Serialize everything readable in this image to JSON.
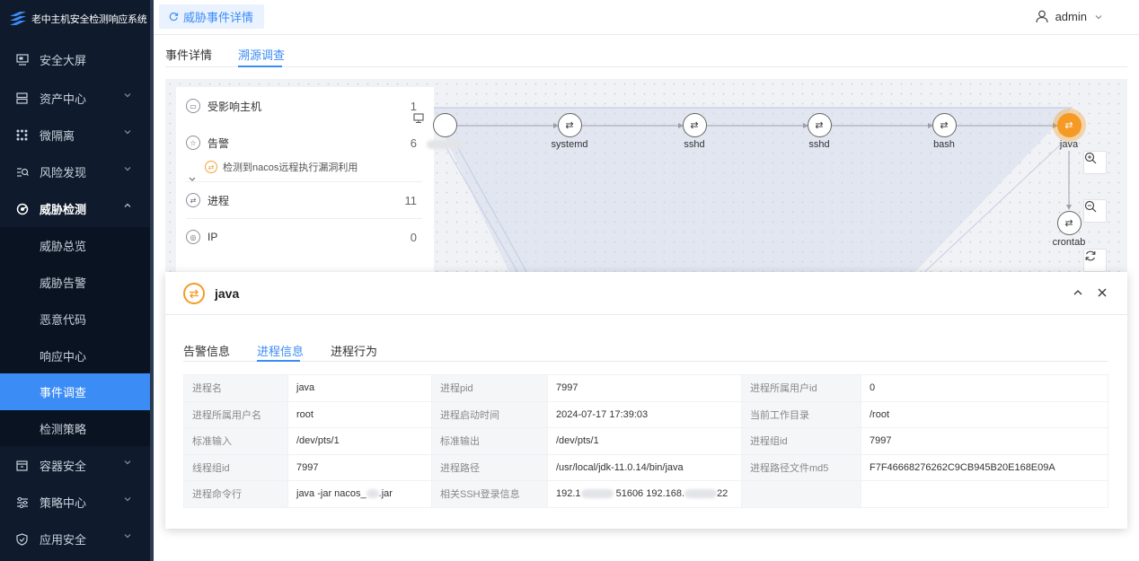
{
  "app": {
    "title": "老中主机安全检测响应系统"
  },
  "sidebar": {
    "items": [
      {
        "label": "安全大屏",
        "icon": "monitor-icon",
        "expandable": false
      },
      {
        "label": "资产中心",
        "icon": "server-icon",
        "expandable": true
      },
      {
        "label": "微隔离",
        "icon": "grid-icon",
        "expandable": true
      },
      {
        "label": "风险发现",
        "icon": "risk-search-icon",
        "expandable": true
      },
      {
        "label": "威胁检测",
        "icon": "threat-icon",
        "expandable": true,
        "open": true
      },
      {
        "label": "容器安全",
        "icon": "container-icon",
        "expandable": true
      },
      {
        "label": "策略中心",
        "icon": "strategy-icon",
        "expandable": true
      },
      {
        "label": "应用安全",
        "icon": "shield-icon",
        "expandable": true
      }
    ],
    "submenu": [
      "威胁总览",
      "威胁告警",
      "恶意代码",
      "响应中心",
      "事件调查",
      "检测策略"
    ],
    "active_sub": "事件调查"
  },
  "topbar": {
    "tab_label": "威胁事件详情",
    "user": "admin"
  },
  "tabs": {
    "items": [
      "事件详情",
      "溯源调查"
    ],
    "active": "溯源调查"
  },
  "stats": {
    "rows": [
      {
        "label": "受影响主机",
        "count": "1",
        "icon": "host-icon"
      },
      {
        "label": "告警",
        "count": "6",
        "icon": "alert-icon"
      },
      {
        "label": "进程",
        "count": "11",
        "icon": "process-icon"
      },
      {
        "label": "IP",
        "count": "0",
        "icon": "ip-icon"
      }
    ],
    "alert_sub": "检测到nacos远程执行漏洞利用"
  },
  "graph": {
    "nodes": [
      "systemd",
      "sshd",
      "sshd",
      "bash",
      "java",
      "crontab"
    ],
    "highlight": "java"
  },
  "detail": {
    "title": "java",
    "tabs": [
      "告警信息",
      "进程信息",
      "进程行为"
    ],
    "active_tab": "进程信息",
    "rows": [
      [
        [
          "进程名",
          "java"
        ],
        [
          "进程pid",
          "7997"
        ],
        [
          "进程所属用户id",
          "0"
        ]
      ],
      [
        [
          "进程所属用户名",
          "root"
        ],
        [
          "进程启动时间",
          "2024-07-17 17:39:03"
        ],
        [
          "当前工作目录",
          "/root"
        ]
      ],
      [
        [
          "标准输入",
          "/dev/pts/1"
        ],
        [
          "标准输出",
          "/dev/pts/1"
        ],
        [
          "进程组id",
          "7997"
        ]
      ],
      [
        [
          "线程组id",
          "7997"
        ],
        [
          "进程路径",
          "/usr/local/jdk-11.0.14/bin/java"
        ],
        [
          "进程路径文件md5",
          "F7F46668276262C9CB945B20E168E09A"
        ]
      ],
      [
        [
          "进程命令行",
          "java -jar nacos_",
          ".jar"
        ],
        [
          "相关SSH登录信息",
          "192.1",
          " 51606 192.168.",
          "22"
        ],
        [
          "",
          ""
        ]
      ]
    ]
  },
  "colors": {
    "accent": "#3c8cf5",
    "sidebar": "#0f1a2c",
    "highlight": "#f59a23"
  }
}
